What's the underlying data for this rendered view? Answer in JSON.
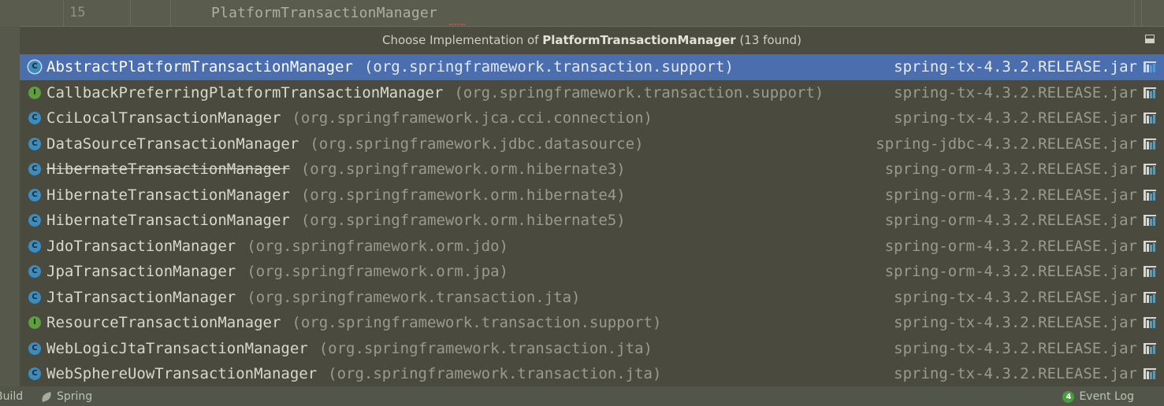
{
  "editor": {
    "line_number": "15",
    "code_text": "PlatformTransactionManager"
  },
  "popup": {
    "title_prefix": "Choose Implementation of ",
    "title_bold": "PlatformTransactionManager",
    "title_suffix": " (13 found)",
    "items": [
      {
        "kind": "C",
        "name": "AbstractPlatformTransactionManager",
        "pkg": "(org.springframework.transaction.support)",
        "jar": "spring-tx-4.3.2.RELEASE.jar",
        "selected": true,
        "deprecated": false
      },
      {
        "kind": "I",
        "name": "CallbackPreferringPlatformTransactionManager",
        "pkg": "(org.springframework.transaction.support)",
        "jar": "spring-tx-4.3.2.RELEASE.jar",
        "selected": false,
        "deprecated": false
      },
      {
        "kind": "C",
        "name": "CciLocalTransactionManager",
        "pkg": "(org.springframework.jca.cci.connection)",
        "jar": "spring-tx-4.3.2.RELEASE.jar",
        "selected": false,
        "deprecated": false
      },
      {
        "kind": "C",
        "name": "DataSourceTransactionManager",
        "pkg": "(org.springframework.jdbc.datasource)",
        "jar": "spring-jdbc-4.3.2.RELEASE.jar",
        "selected": false,
        "deprecated": false
      },
      {
        "kind": "C",
        "name": "HibernateTransactionManager",
        "pkg": "(org.springframework.orm.hibernate3)",
        "jar": "spring-orm-4.3.2.RELEASE.jar",
        "selected": false,
        "deprecated": true
      },
      {
        "kind": "C",
        "name": "HibernateTransactionManager",
        "pkg": "(org.springframework.orm.hibernate4)",
        "jar": "spring-orm-4.3.2.RELEASE.jar",
        "selected": false,
        "deprecated": false
      },
      {
        "kind": "C",
        "name": "HibernateTransactionManager",
        "pkg": "(org.springframework.orm.hibernate5)",
        "jar": "spring-orm-4.3.2.RELEASE.jar",
        "selected": false,
        "deprecated": false
      },
      {
        "kind": "C",
        "name": "JdoTransactionManager",
        "pkg": "(org.springframework.orm.jdo)",
        "jar": "spring-orm-4.3.2.RELEASE.jar",
        "selected": false,
        "deprecated": false
      },
      {
        "kind": "C",
        "name": "JpaTransactionManager",
        "pkg": "(org.springframework.orm.jpa)",
        "jar": "spring-orm-4.3.2.RELEASE.jar",
        "selected": false,
        "deprecated": false
      },
      {
        "kind": "C",
        "name": "JtaTransactionManager",
        "pkg": "(org.springframework.transaction.jta)",
        "jar": "spring-tx-4.3.2.RELEASE.jar",
        "selected": false,
        "deprecated": false
      },
      {
        "kind": "I",
        "name": "ResourceTransactionManager",
        "pkg": "(org.springframework.transaction.support)",
        "jar": "spring-tx-4.3.2.RELEASE.jar",
        "selected": false,
        "deprecated": false
      },
      {
        "kind": "C",
        "name": "WebLogicJtaTransactionManager",
        "pkg": "(org.springframework.transaction.jta)",
        "jar": "spring-tx-4.3.2.RELEASE.jar",
        "selected": false,
        "deprecated": false
      },
      {
        "kind": "C",
        "name": "WebSphereUowTransactionManager",
        "pkg": "(org.springframework.transaction.jta)",
        "jar": "spring-tx-4.3.2.RELEASE.jar",
        "selected": false,
        "deprecated": false
      }
    ]
  },
  "statusbar": {
    "build_label": "Build",
    "spring_label": "Spring",
    "event_count": "4",
    "event_label": "Event Log"
  },
  "colors": {
    "selection": "#4b6eaf",
    "class_badge": "#3b8cbf",
    "interface_badge": "#5e9e3d"
  }
}
